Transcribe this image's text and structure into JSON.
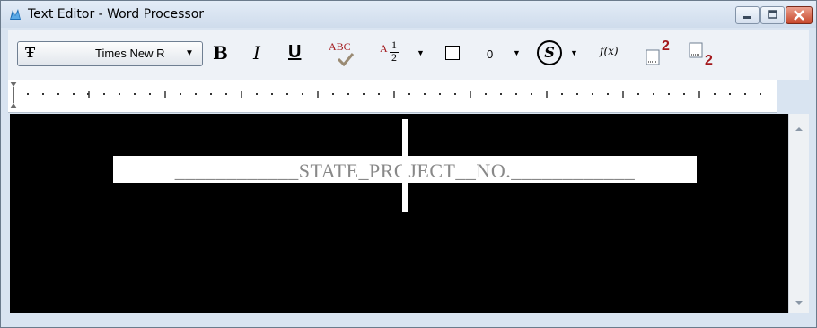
{
  "window": {
    "title": "Text Editor - Word Processor"
  },
  "toolbar": {
    "font_name": "Times New R",
    "bold": "B",
    "italic": "I",
    "underline": "U",
    "spell_label": "ABC",
    "fraction_a": "A",
    "fraction_top": "1",
    "fraction_bottom": "2",
    "spacing_value": "0",
    "symbol_letter": "S",
    "function_label": "f(x)",
    "superscript_digit": "2",
    "subscript_digit": "2"
  },
  "document": {
    "text": "____________STATE_PROJECT__NO.____________"
  },
  "colors": {
    "editor_bg": "#000000",
    "accent_red": "#a3181c",
    "text": "#888888"
  },
  "icons": [
    "app-icon",
    "minimize-icon",
    "maximize-icon",
    "close-icon",
    "font-icon",
    "check-icon",
    "checkbox-icon",
    "superscript-icon",
    "subscript-icon",
    "tab-stop-icon",
    "scroll-up-icon",
    "scroll-down-icon"
  ]
}
